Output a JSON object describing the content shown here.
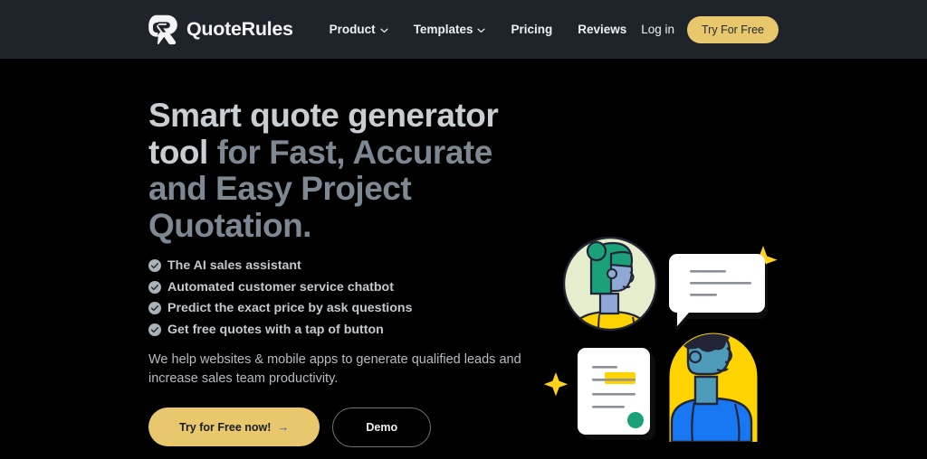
{
  "navbar": {
    "logo": {
      "icon": "quote-rules-logo-icon",
      "name_a": "Quote",
      "name_b": "Rules"
    },
    "links": [
      {
        "label": "Product",
        "has_caret": true
      },
      {
        "label": "Templates",
        "has_caret": true
      },
      {
        "label": "Pricing",
        "has_caret": false
      },
      {
        "label": "Reviews",
        "has_caret": false
      }
    ],
    "login_label": "Log in",
    "cta_label": "Try For Free"
  },
  "hero": {
    "headline_bright": "Smart quote generator tool ",
    "headline_dim": "for Fast, Accurate and Easy Project Quotation.",
    "features": [
      "The AI sales assistant",
      "Automated customer service chatbot",
      "Predict the exact price by ask questions",
      "Get free quotes with a tap of button"
    ],
    "lede": "We help websites & mobile apps to generate qualified leads and increase sales team productivity.",
    "primary_button": {
      "label": "Try for Free now!",
      "arrow": "→"
    },
    "secondary_button": {
      "label": "Demo"
    }
  },
  "illustration": {
    "name": "ai-quote-illustration",
    "parts": [
      "avatar-green-circle",
      "chat-bubble-card",
      "document-card",
      "avatar-yellow-arch",
      "sparkle-star-top",
      "sparkle-star-left"
    ]
  },
  "colors": {
    "page_bg": "#000000",
    "navbar_bg": "#1e2429",
    "accent_gold": "#e9c86d",
    "headline_bright": "#c9ced3",
    "headline_dim": "#7e8892",
    "body_text": "#b6bcc2",
    "illustration_yellow": "#ffd300",
    "illustration_blue": "#1877f2",
    "illustration_teal": "#1aa179",
    "illustration_green_bg": "#e2eece",
    "illustration_skin": "#8fa8d5",
    "illustration_skin2": "#4e9bb9",
    "illustration_dark": "#232536"
  }
}
